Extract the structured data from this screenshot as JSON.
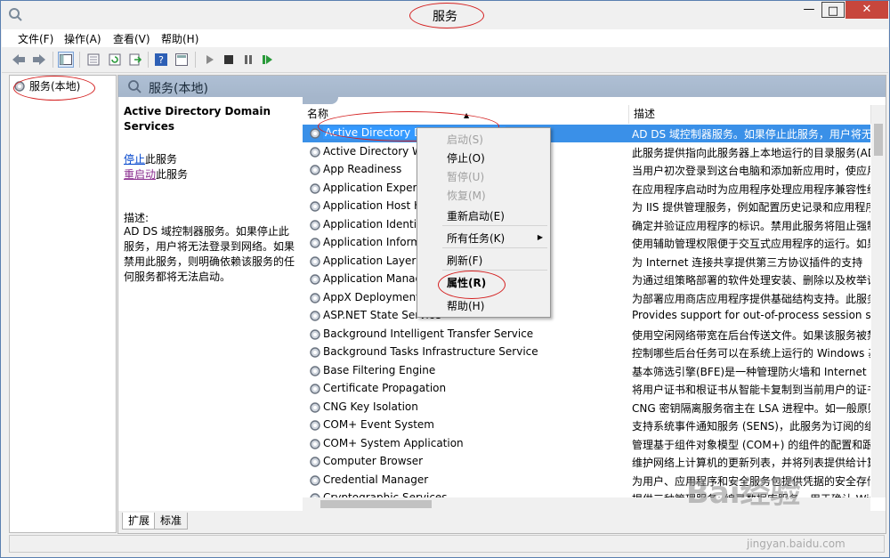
{
  "window": {
    "title": "服务",
    "controls": {
      "minimize": "—",
      "maximize": "□",
      "close": "✕"
    }
  },
  "menubar": {
    "items": [
      "文件(F)",
      "操作(A)",
      "查看(V)",
      "帮助(H)"
    ]
  },
  "toolbar": {
    "icons": [
      "back-arrow-icon",
      "forward-arrow-icon",
      "console-tree-icon",
      "properties-icon",
      "refresh-icon",
      "export-icon",
      "help-icon",
      "view-icon",
      "start-service-icon",
      "stop-service-icon",
      "pause-service-icon",
      "resume-service-icon"
    ]
  },
  "tree": {
    "root_label": "服务(本地)"
  },
  "main": {
    "header": "服务(本地)",
    "desc_pane": {
      "title": "Active Directory Domain Services",
      "stop_link": "停止",
      "stop_suffix": "此服务",
      "restart_link": "重启动",
      "restart_suffix": "此服务",
      "desc_label": "描述:",
      "description": "AD DS 域控制器服务。如果停止此服务，用户将无法登录到网络。如果禁用此服务，则明确依赖该服务的任何服务都将无法启动。"
    },
    "columns": {
      "name": "名称",
      "description": "描述"
    },
    "services": [
      {
        "name": "Active Directory Domain Services",
        "description": "AD DS 域控制器服务。如果停止此服务，用户将无"
      },
      {
        "name": "Active Directory Web Services",
        "description": "此服务提供指向此服务器上本地运行的目录服务(AD"
      },
      {
        "name": "App Readiness",
        "description": "当用户初次登录到这台电脑和添加新应用时，使应用"
      },
      {
        "name": "Application Experience",
        "description": "在应用程序启动时为应用程序处理应用程序兼容性缓"
      },
      {
        "name": "Application Host Helper Service",
        "description": "为 IIS 提供管理服务，例如配置历史记录和应用程序"
      },
      {
        "name": "Application Identity",
        "description": "确定并验证应用程序的标识。禁用此服务将阻止强制"
      },
      {
        "name": "Application Information",
        "description": "使用辅助管理权限便于交互式应用程序的运行。如果"
      },
      {
        "name": "Application Layer Gateway Service",
        "description": "为 Internet 连接共享提供第三方协议插件的支持"
      },
      {
        "name": "Application Management",
        "description": "为通过组策略部署的软件处理安装、删除以及枚举请"
      },
      {
        "name": "AppX Deployment Service (AppXSVC)",
        "description": "为部署应用商店应用程序提供基础结构支持。此服务"
      },
      {
        "name": "ASP.NET State Service",
        "description": "Provides support for out-of-process session st"
      },
      {
        "name": "Background Intelligent Transfer Service",
        "description": "使用空闲网络带宽在后台传送文件。如果该服务被禁"
      },
      {
        "name": "Background Tasks Infrastructure Service",
        "description": "控制哪些后台任务可以在系统上运行的 Windows 基"
      },
      {
        "name": "Base Filtering Engine",
        "description": "基本筛选引擎(BFE)是一种管理防火墙和 Internet 协"
      },
      {
        "name": "Certificate Propagation",
        "description": "将用户证书和根证书从智能卡复制到当前用户的证书"
      },
      {
        "name": "CNG Key Isolation",
        "description": "CNG 密钥隔离服务宿主在 LSA 进程中。如一般原则"
      },
      {
        "name": "COM+ Event System",
        "description": "支持系统事件通知服务 (SENS)，此服务为订阅的组"
      },
      {
        "name": "COM+ System Application",
        "description": "管理基于组件对象模型 (COM+) 的组件的配置和跟"
      },
      {
        "name": "Computer Browser",
        "description": "维护网络上计算机的更新列表，并将列表提供给计算"
      },
      {
        "name": "Credential Manager",
        "description": "为用户、应用程序和安全服务包提供凭据的安全存储"
      },
      {
        "name": "Cryptographic Services",
        "description": "提供三种管理服务: 编录数据库服务，用于确认 Win"
      }
    ],
    "tabs": [
      "扩展",
      "标准"
    ]
  },
  "context_menu": {
    "items": [
      {
        "label": "启动(S)",
        "disabled": true
      },
      {
        "label": "停止(O)",
        "disabled": false
      },
      {
        "label": "暂停(U)",
        "disabled": true
      },
      {
        "label": "恢复(M)",
        "disabled": true
      },
      {
        "label": "重新启动(E)",
        "disabled": false
      },
      {
        "label": "所有任务(K)",
        "disabled": false
      },
      {
        "label": "刷新(F)",
        "disabled": false
      },
      {
        "label": "属性(R)",
        "disabled": false
      },
      {
        "label": "帮助(H)",
        "disabled": false
      }
    ]
  },
  "watermark": {
    "logo": "Bai经验",
    "url": "jingyan.baidu.com"
  },
  "colors": {
    "annotation": "#d42020",
    "selection": "#3a90e8",
    "link": "#0044cc"
  }
}
